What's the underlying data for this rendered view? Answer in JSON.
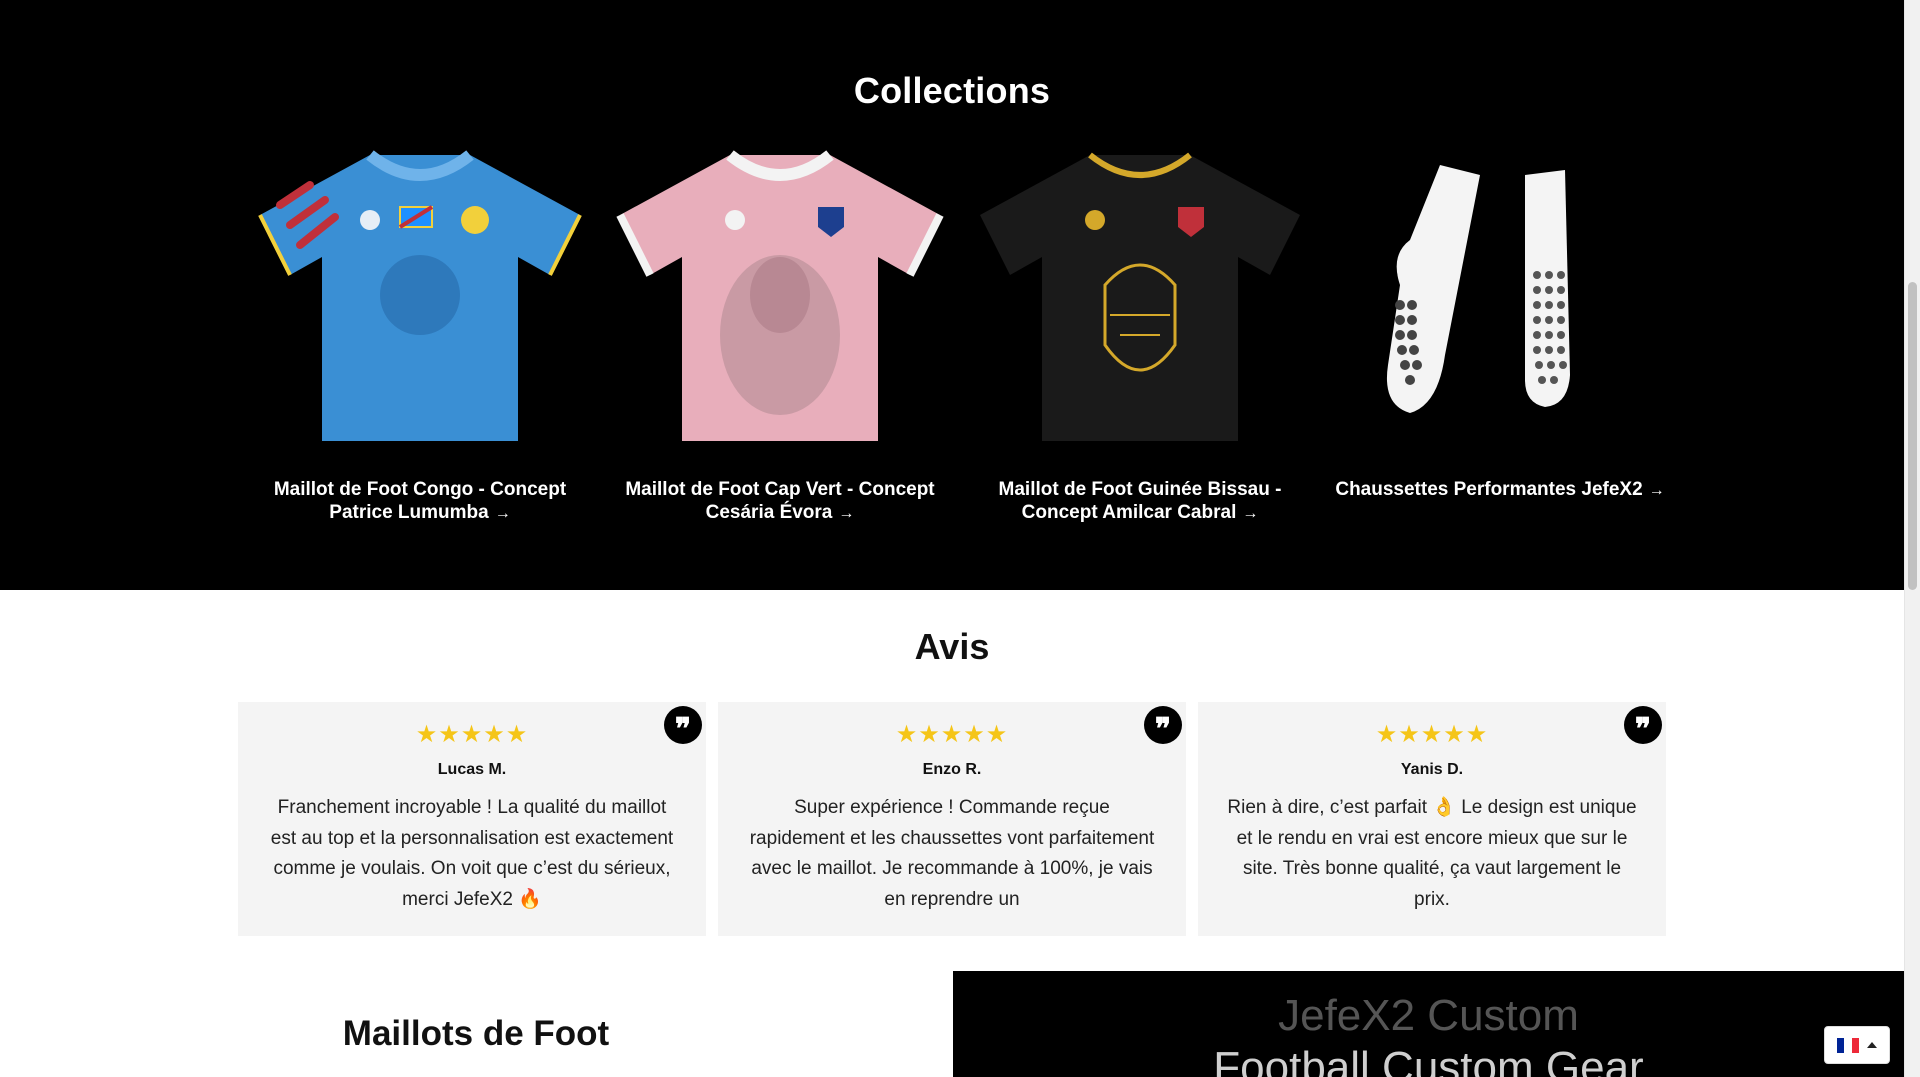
{
  "collections": {
    "title": "Collections",
    "items": [
      {
        "title": "Maillot de Foot Congo - Concept Patrice Lumumba",
        "arrow": "→",
        "color": "#3a8fd4"
      },
      {
        "title": "Maillot de Foot Cap Vert - Concept Cesária Évora",
        "arrow": "→",
        "color": "#e8aebb"
      },
      {
        "title": "Maillot de Foot Guinée Bissau - Concept Amilcar Cabral",
        "arrow": "→",
        "color": "#1a1a1a"
      },
      {
        "title": "Chaussettes Performantes JefeX2",
        "arrow": "→",
        "color": "#f4f4f4"
      }
    ]
  },
  "reviews": {
    "title": "Avis",
    "items": [
      {
        "stars": "★★★★★",
        "author": "Lucas M.",
        "text": "Franchement incroyable ! La qualité du maillot est au top et la personnalisation est exactement comme je voulais. On voit que c’est du sérieux, merci JefeX2 🔥"
      },
      {
        "stars": "★★★★★",
        "author": "Enzo R.",
        "text": "Super expérience ! Commande reçue rapidement et les chaussettes vont parfaitement avec le maillot. Je recommande à 100%, je vais en reprendre un"
      },
      {
        "stars": "★★★★★",
        "author": "Yanis D.",
        "text": "Rien à dire, c’est parfait 👌 Le design est unique et le rendu en vrai est encore mieux que sur le site. Très bonne qualité, ça vaut largement le prix."
      }
    ],
    "quote_glyph": "❞"
  },
  "bottom": {
    "title": "Maillots de Foot",
    "video_line1": "JefeX2 Custom",
    "video_line2": "Football Custom Gear"
  },
  "colors": {
    "star": "#f5c518",
    "flag_blue": "#002395",
    "flag_white": "#ffffff",
    "flag_red": "#ed2939"
  }
}
